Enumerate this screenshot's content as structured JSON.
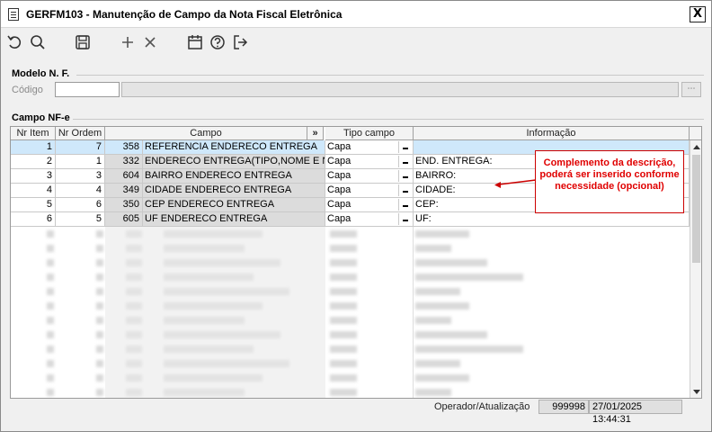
{
  "window": {
    "title": "GERFM103 - Manutenção de Campo da Nota Fiscal Eletrônica",
    "close_glyph": "X"
  },
  "toolbar": {
    "icons": [
      "undo-icon",
      "search-icon",
      "save-icon",
      "add-icon",
      "delete-icon",
      "calendar-icon",
      "help-icon",
      "exit-icon"
    ]
  },
  "modelo": {
    "group_label": "Modelo N. F.",
    "codigo_label": "Código",
    "codigo_value": "",
    "descricao_value": ""
  },
  "campos": {
    "group_label": "Campo NF-e",
    "columns": {
      "nr_item": "Nr Item",
      "nr_ordem": "Nr Ordem",
      "campo": "Campo",
      "campo_btn": "»",
      "tipo_campo": "Tipo campo",
      "informacao": "Informação"
    },
    "rows": [
      {
        "nr_item": "1",
        "nr_ordem": "7",
        "codigo": "358",
        "campo": "REFERENCIA ENDERECO ENTREGA",
        "tipo": "Capa",
        "info": ""
      },
      {
        "nr_item": "2",
        "nr_ordem": "1",
        "codigo": "332",
        "campo": "ENDERECO ENTREGA(TIPO,NOME E NR. D",
        "tipo": "Capa",
        "info": "END. ENTREGA:"
      },
      {
        "nr_item": "3",
        "nr_ordem": "3",
        "codigo": "604",
        "campo": "BAIRRO ENDERECO ENTREGA",
        "tipo": "Capa",
        "info": "BAIRRO:"
      },
      {
        "nr_item": "4",
        "nr_ordem": "4",
        "codigo": "349",
        "campo": "CIDADE ENDERECO ENTREGA",
        "tipo": "Capa",
        "info": "CIDADE:"
      },
      {
        "nr_item": "5",
        "nr_ordem": "6",
        "codigo": "350",
        "campo": "CEP ENDERECO ENTREGA",
        "tipo": "Capa",
        "info": "CEP:"
      },
      {
        "nr_item": "6",
        "nr_ordem": "5",
        "codigo": "605",
        "campo": "UF ENDERECO ENTREGA",
        "tipo": "Capa",
        "info": "UF:"
      }
    ]
  },
  "callout": {
    "text": "Complemento da descrição, poderá ser inserido conforme necessidade (opcional)",
    "color": "#e00000"
  },
  "status": {
    "label": "Operador/Atualização",
    "operator": "999998",
    "datetime": "27/01/2025 13:44:31"
  },
  "colors": {
    "selected_row": "#cfe8fb",
    "readonly_cell": "#dcdcdc",
    "callout_border": "#cc0000"
  }
}
